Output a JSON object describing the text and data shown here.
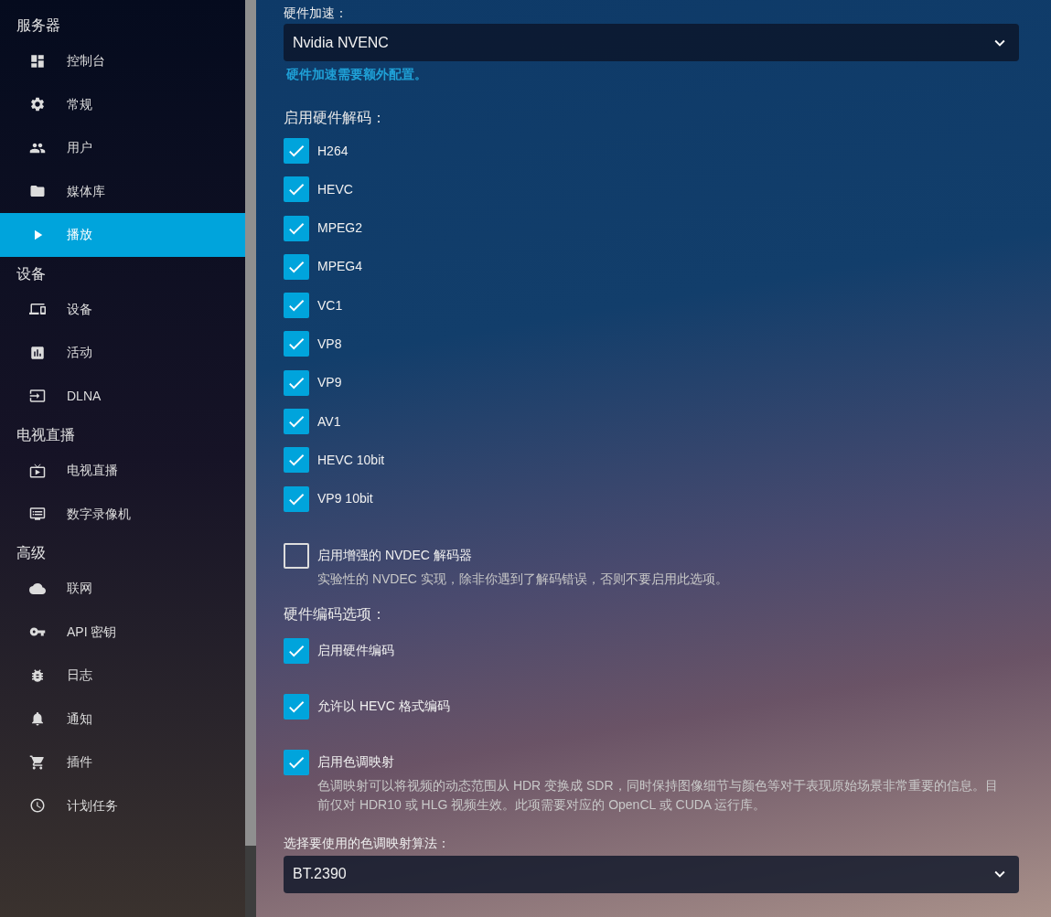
{
  "sidebar": {
    "sections": [
      {
        "title": "服务器",
        "items": [
          {
            "label": "控制台",
            "selected": false
          },
          {
            "label": "常规",
            "selected": false
          },
          {
            "label": "用户",
            "selected": false
          },
          {
            "label": "媒体库",
            "selected": false
          },
          {
            "label": "播放",
            "selected": true
          }
        ]
      },
      {
        "title": "设备",
        "items": [
          {
            "label": "设备",
            "selected": false
          },
          {
            "label": "活动",
            "selected": false
          },
          {
            "label": "DLNA",
            "selected": false
          }
        ]
      },
      {
        "title": "电视直播",
        "items": [
          {
            "label": "电视直播",
            "selected": false
          },
          {
            "label": "数字录像机",
            "selected": false
          }
        ]
      },
      {
        "title": "高级",
        "items": [
          {
            "label": "联网",
            "selected": false
          },
          {
            "label": "API 密钥",
            "selected": false
          },
          {
            "label": "日志",
            "selected": false
          },
          {
            "label": "通知",
            "selected": false
          },
          {
            "label": "插件",
            "selected": false
          },
          {
            "label": "计划任务",
            "selected": false
          }
        ]
      }
    ]
  },
  "hardware_acceleration": {
    "label": "硬件加速：",
    "value": "Nvidia NVENC",
    "hint": "硬件加速需要额外配置。"
  },
  "decoding": {
    "heading": "启用硬件解码：",
    "options": [
      {
        "label": "H264",
        "checked": true
      },
      {
        "label": "HEVC",
        "checked": true
      },
      {
        "label": "MPEG2",
        "checked": true
      },
      {
        "label": "MPEG4",
        "checked": true
      },
      {
        "label": "VC1",
        "checked": true
      },
      {
        "label": "VP8",
        "checked": true
      },
      {
        "label": "VP9",
        "checked": true
      },
      {
        "label": "AV1",
        "checked": true
      },
      {
        "label": "HEVC 10bit",
        "checked": true
      },
      {
        "label": "VP9 10bit",
        "checked": true
      }
    ]
  },
  "nvdec": {
    "label": "启用增强的 NVDEC 解码器",
    "checked": false,
    "description": "实验性的 NVDEC 实现，除非你遇到了解码错误，否则不要启用此选项。"
  },
  "encoding": {
    "heading": "硬件编码选项：",
    "options": [
      {
        "label": "启用硬件编码",
        "checked": true
      },
      {
        "label": "允许以 HEVC 格式编码",
        "checked": true
      },
      {
        "label": "启用色调映射",
        "checked": true,
        "description": "色调映射可以将视频的动态范围从 HDR 变换成 SDR，同时保持图像细节与颜色等对于表现原始场景非常重要的信息。目前仅对 HDR10 或 HLG 视频生效。此项需要对应的 OpenCL 或 CUDA 运行库。"
      }
    ]
  },
  "tone_mapping_algorithm": {
    "label": "选择要使用的色调映射算法：",
    "value": "BT.2390"
  }
}
